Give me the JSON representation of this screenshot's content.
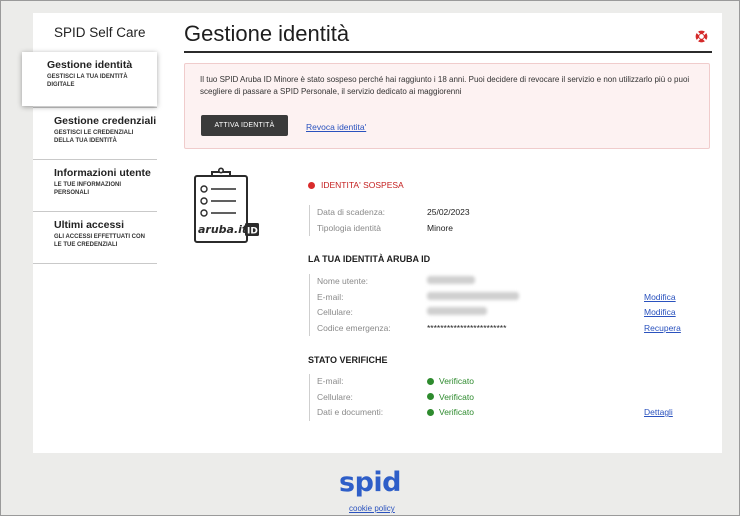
{
  "sidebar": {
    "app_title": "SPID Self Care",
    "items": [
      {
        "title": "Gestione identità",
        "subtitle": "GESTISCI LA TUA IDENTITÀ DIGITALE",
        "active": true
      },
      {
        "title": "Gestione credenziali",
        "subtitle": "GESTISCI LE CREDENZIALI DELLA TUA IDENTITÀ",
        "active": false
      },
      {
        "title": "Informazioni utente",
        "subtitle": "LE TUE INFORMAZIONI PERSONALI",
        "active": false
      },
      {
        "title": "Ultimi accessi",
        "subtitle": "GLI ACCESSI EFFETTUATI CON LE TUE CREDENZIALI",
        "active": false
      }
    ]
  },
  "header": {
    "title": "Gestione identità",
    "help_icon": "lifebuoy-icon"
  },
  "alert": {
    "message": "Il tuo SPID Aruba ID Minore è stato sospeso perché  hai raggiunto i 18 anni. Puoi decidere di revocare il servizio e non utilizzarlo più o puoi scegliere di passare a SPID Personale, il servizio dedicato ai maggiorenni",
    "primary_button": "ATTIVA IDENTITÀ",
    "secondary_link": "Revoca identita'"
  },
  "identity": {
    "icon": "aruba-id-clipboard-icon",
    "icon_brand_text": "aruba.it",
    "icon_brand_badge": "ID",
    "status": "IDENTITA' SOSPESA",
    "status_color": "#d92b2b",
    "fields": [
      {
        "label": "Data di scadenza:",
        "value": "25/02/2023"
      },
      {
        "label": "Tipologia identità",
        "value": "Minore"
      }
    ]
  },
  "account": {
    "heading": "LA TUA IDENTITÀ ARUBA ID",
    "fields": [
      {
        "label": "Nome utente:",
        "value": "",
        "action": ""
      },
      {
        "label": "E-mail:",
        "value": "",
        "action": "Modifica"
      },
      {
        "label": "Cellulare:",
        "value": "",
        "action": "Modifica"
      },
      {
        "label": "Codice emergenza:",
        "value": "************************",
        "action": "Recupera"
      }
    ]
  },
  "verifications": {
    "heading": "STATO VERIFICHE",
    "status_color": "#2e8b2e",
    "items": [
      {
        "label": "E-mail:",
        "status": "Verificato",
        "action": ""
      },
      {
        "label": "Cellulare:",
        "status": "Verificato",
        "action": ""
      },
      {
        "label": "Dati e documenti:",
        "status": "Verificato",
        "action": "Dettagli"
      }
    ]
  },
  "footer": {
    "logo_text": "spid",
    "brand_color": "#2e5ec8",
    "cookie_link": "cookie policy"
  }
}
